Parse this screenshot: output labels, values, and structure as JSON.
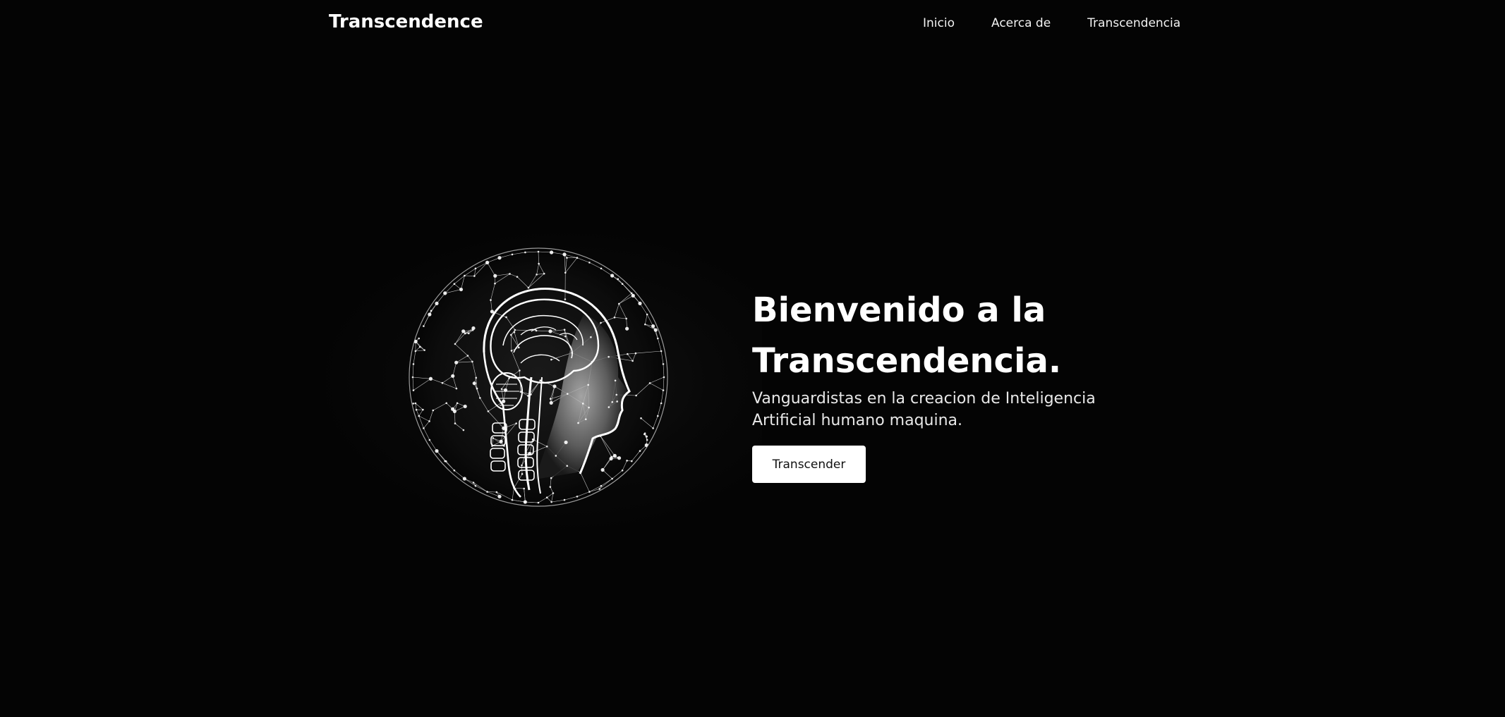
{
  "header": {
    "brand": "Transcendence",
    "nav": [
      {
        "label": "Inicio"
      },
      {
        "label": "Acerca de"
      },
      {
        "label": "Transcendencia"
      }
    ]
  },
  "hero": {
    "title_line1": "Bienvenido a la",
    "title_line2": "Transcendencia.",
    "subtitle": "Vanguardistas en la creacion de Inteligencia Artificial humano maquina.",
    "button_label": "Transcender",
    "image_icon": "ai-head-network-sphere"
  },
  "colors": {
    "background": "#040404",
    "text": "#ffffff",
    "button_bg": "#ffffff",
    "button_text": "#111111"
  }
}
